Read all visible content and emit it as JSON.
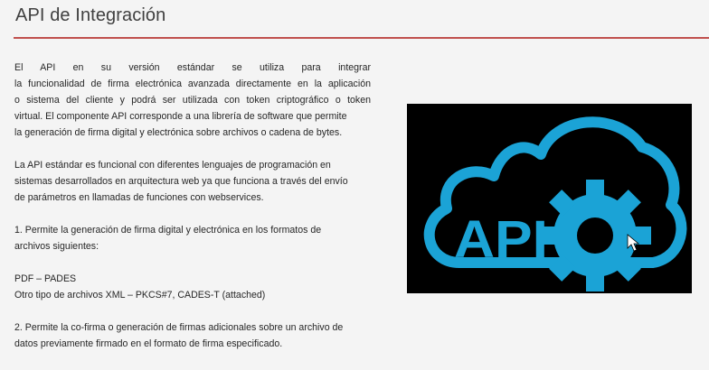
{
  "slide": {
    "title": "API de Integración"
  },
  "paragraph1": {
    "lines": [
      "El API en su versión estándar se utiliza para integrar",
      "la funcionalidad de firma electrónica avanzada directamente en la aplicación",
      "o sistema del cliente y podrá ser utilizada con token criptográfico o token",
      "virtual. El componente API corresponde a una librería de software que permite",
      "la generación de firma digital y electrónica sobre archivos o cadena de bytes."
    ]
  },
  "paragraph2": {
    "lines": [
      "La API estándar es funcional con diferentes lenguajes de programación en",
      "sistemas desarrollados en arquitectura web ya que funciona a través del envío",
      "de parámetros en llamadas de funciones con webservices."
    ]
  },
  "item1": {
    "lines": [
      "1. Permite la generación de firma digital y electrónica en los formatos de",
      "archivos siguientes:"
    ]
  },
  "formats": {
    "line1": "PDF – PADES",
    "line2": "Otro tipo de archivos XML – PKCS#7, CADES-T (attached)"
  },
  "item2": {
    "lines": [
      "2. Permite la co-firma o generación de firmas adicionales sobre un archivo de",
      "datos previamente firmado en el formato de firma especificado."
    ]
  },
  "image": {
    "label": "API",
    "icon": "cloud-gear-icon",
    "background": "#000000",
    "accent": "#1ba3d6"
  },
  "colors": {
    "rule": "#c0504d",
    "title": "#404040",
    "text": "#262626"
  }
}
